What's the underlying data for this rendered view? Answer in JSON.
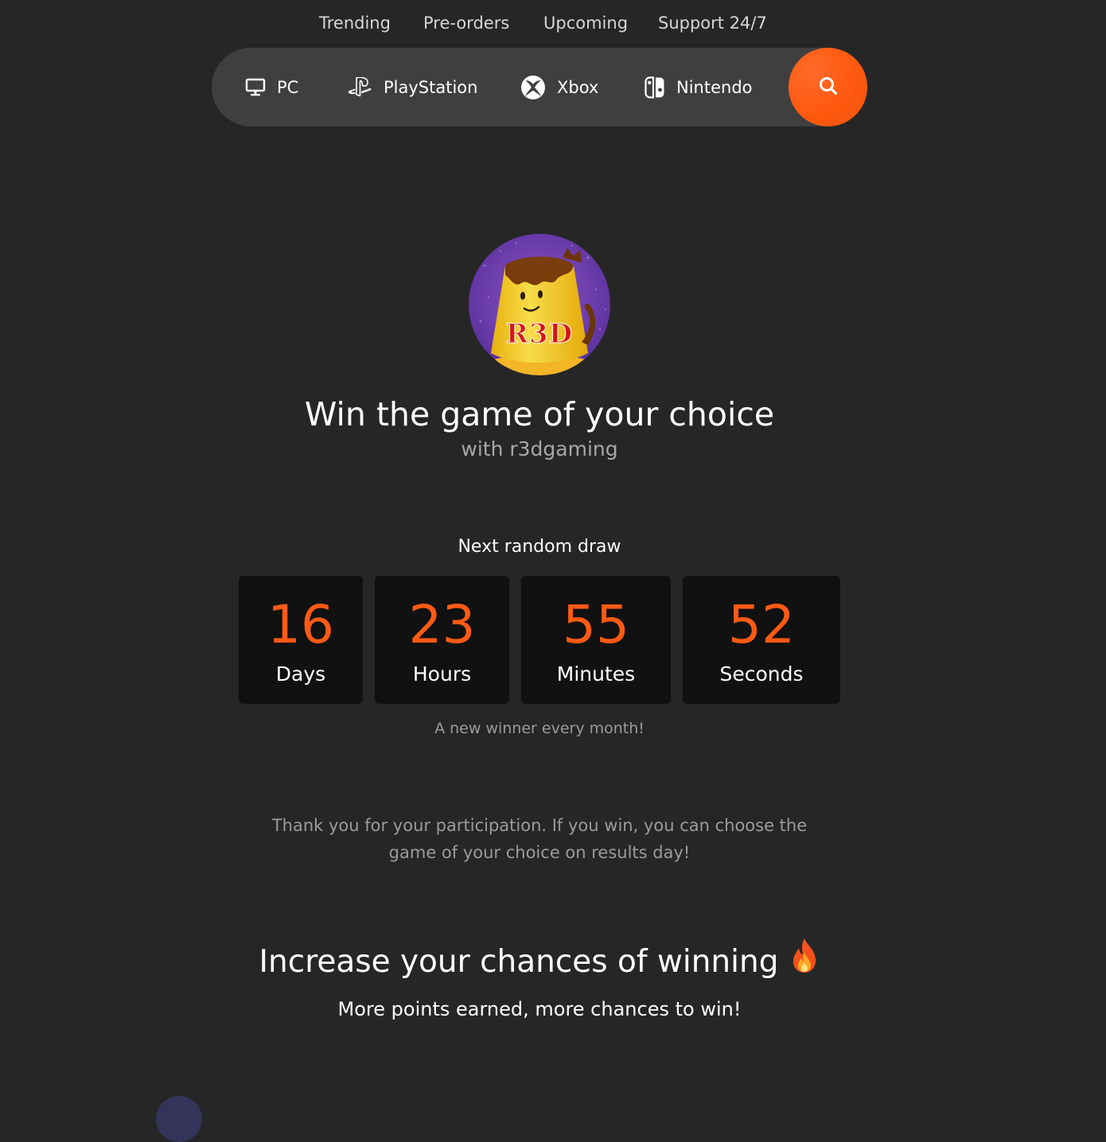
{
  "topnav": {
    "items": [
      {
        "label": "Trending"
      },
      {
        "label": "Pre-orders"
      },
      {
        "label": "Upcoming"
      },
      {
        "label": "Support 24/7"
      }
    ]
  },
  "platforms": {
    "items": [
      {
        "label": "PC",
        "icon": "monitor-icon"
      },
      {
        "label": "PlayStation",
        "icon": "playstation-icon"
      },
      {
        "label": "Xbox",
        "icon": "xbox-icon"
      },
      {
        "label": "Nintendo",
        "icon": "nintendo-switch-icon"
      }
    ],
    "search_icon": "search-icon",
    "accent_color": "#ff5a14"
  },
  "hero": {
    "logo_text": "R3D",
    "title": "Win the game of your choice",
    "subtitle": "with r3dgaming"
  },
  "countdown": {
    "label": "Next random draw",
    "units": [
      {
        "value": "16",
        "unit": "Days"
      },
      {
        "value": "23",
        "unit": "Hours"
      },
      {
        "value": "55",
        "unit": "Minutes"
      },
      {
        "value": "52",
        "unit": "Seconds"
      }
    ],
    "note": "A new winner every month!"
  },
  "thanks": {
    "text": "Thank you for your participation. If you win, you can choose the game of your choice on results day!"
  },
  "chances": {
    "title": "Increase your chances of winning",
    "icon": "fire-icon",
    "subtitle": "More points earned, more chances to win!"
  }
}
